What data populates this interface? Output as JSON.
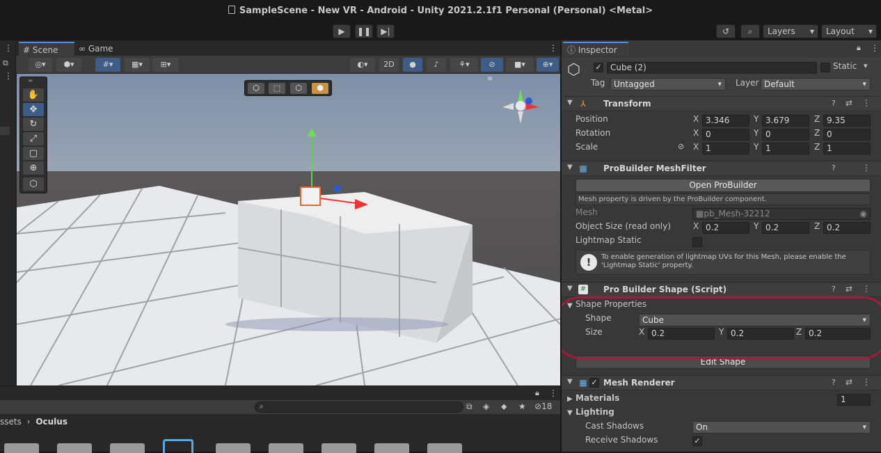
{
  "window": {
    "title": "SampleScene - New VR - Android - Unity 2021.2.1f1 Personal (Personal) <Metal>"
  },
  "toolbar": {
    "layers_label": "Layers",
    "layout_label": "Layout"
  },
  "scene_panel": {
    "tabs": [
      {
        "label": "Scene"
      },
      {
        "label": "Game"
      }
    ],
    "toggle_2d": "2D"
  },
  "project_panel": {
    "breadcrumb": [
      "ssets",
      "Oculus"
    ],
    "search_placeholder": "",
    "hidden_count": "18"
  },
  "inspector": {
    "tab_label": "Inspector",
    "object": {
      "name": "Cube (2)",
      "static_label": "Static",
      "tag_label": "Tag",
      "tag_value": "Untagged",
      "layer_label": "Layer",
      "layer_value": "Default"
    },
    "transform": {
      "title": "Transform",
      "position": {
        "label": "Position",
        "x": "3.346",
        "y": "3.679",
        "z": "9.35"
      },
      "rotation": {
        "label": "Rotation",
        "x": "0",
        "y": "0",
        "z": "0"
      },
      "scale": {
        "label": "Scale",
        "x": "1",
        "y": "1",
        "z": "1"
      }
    },
    "meshfilter": {
      "title": "ProBuilder MeshFilter",
      "open_button": "Open ProBuilder",
      "driven_note": "Mesh property is driven by the ProBuilder component.",
      "mesh_label": "Mesh",
      "mesh_value": "pb_Mesh-32212",
      "object_size_label": "Object Size (read only)",
      "size": {
        "x": "0.2",
        "y": "0.2",
        "z": "0.2"
      },
      "lightmap_label": "Lightmap Static",
      "help_text": "To enable generation of lightmap UVs for this Mesh, please enable the 'Lightmap Static' property."
    },
    "shape_script": {
      "title": "Pro Builder Shape (Script)",
      "shape_properties_label": "Shape Properties",
      "shape_label": "Shape",
      "shape_value": "Cube",
      "size_label": "Size",
      "size": {
        "x": "0.2",
        "y": "0.2",
        "z": "0.2"
      },
      "edit_button": "Edit Shape"
    },
    "mesh_renderer": {
      "title": "Mesh Renderer",
      "materials_label": "Materials",
      "materials_count": "1",
      "lighting_label": "Lighting",
      "cast_shadows_label": "Cast Shadows",
      "cast_shadows_value": "On",
      "receive_shadows_label": "Receive Shadows"
    }
  },
  "axis_letters": {
    "x": "X",
    "y": "Y",
    "z": "Z"
  },
  "colors": {
    "highlight": "#a51b3a",
    "accent": "#4d8fe0"
  }
}
